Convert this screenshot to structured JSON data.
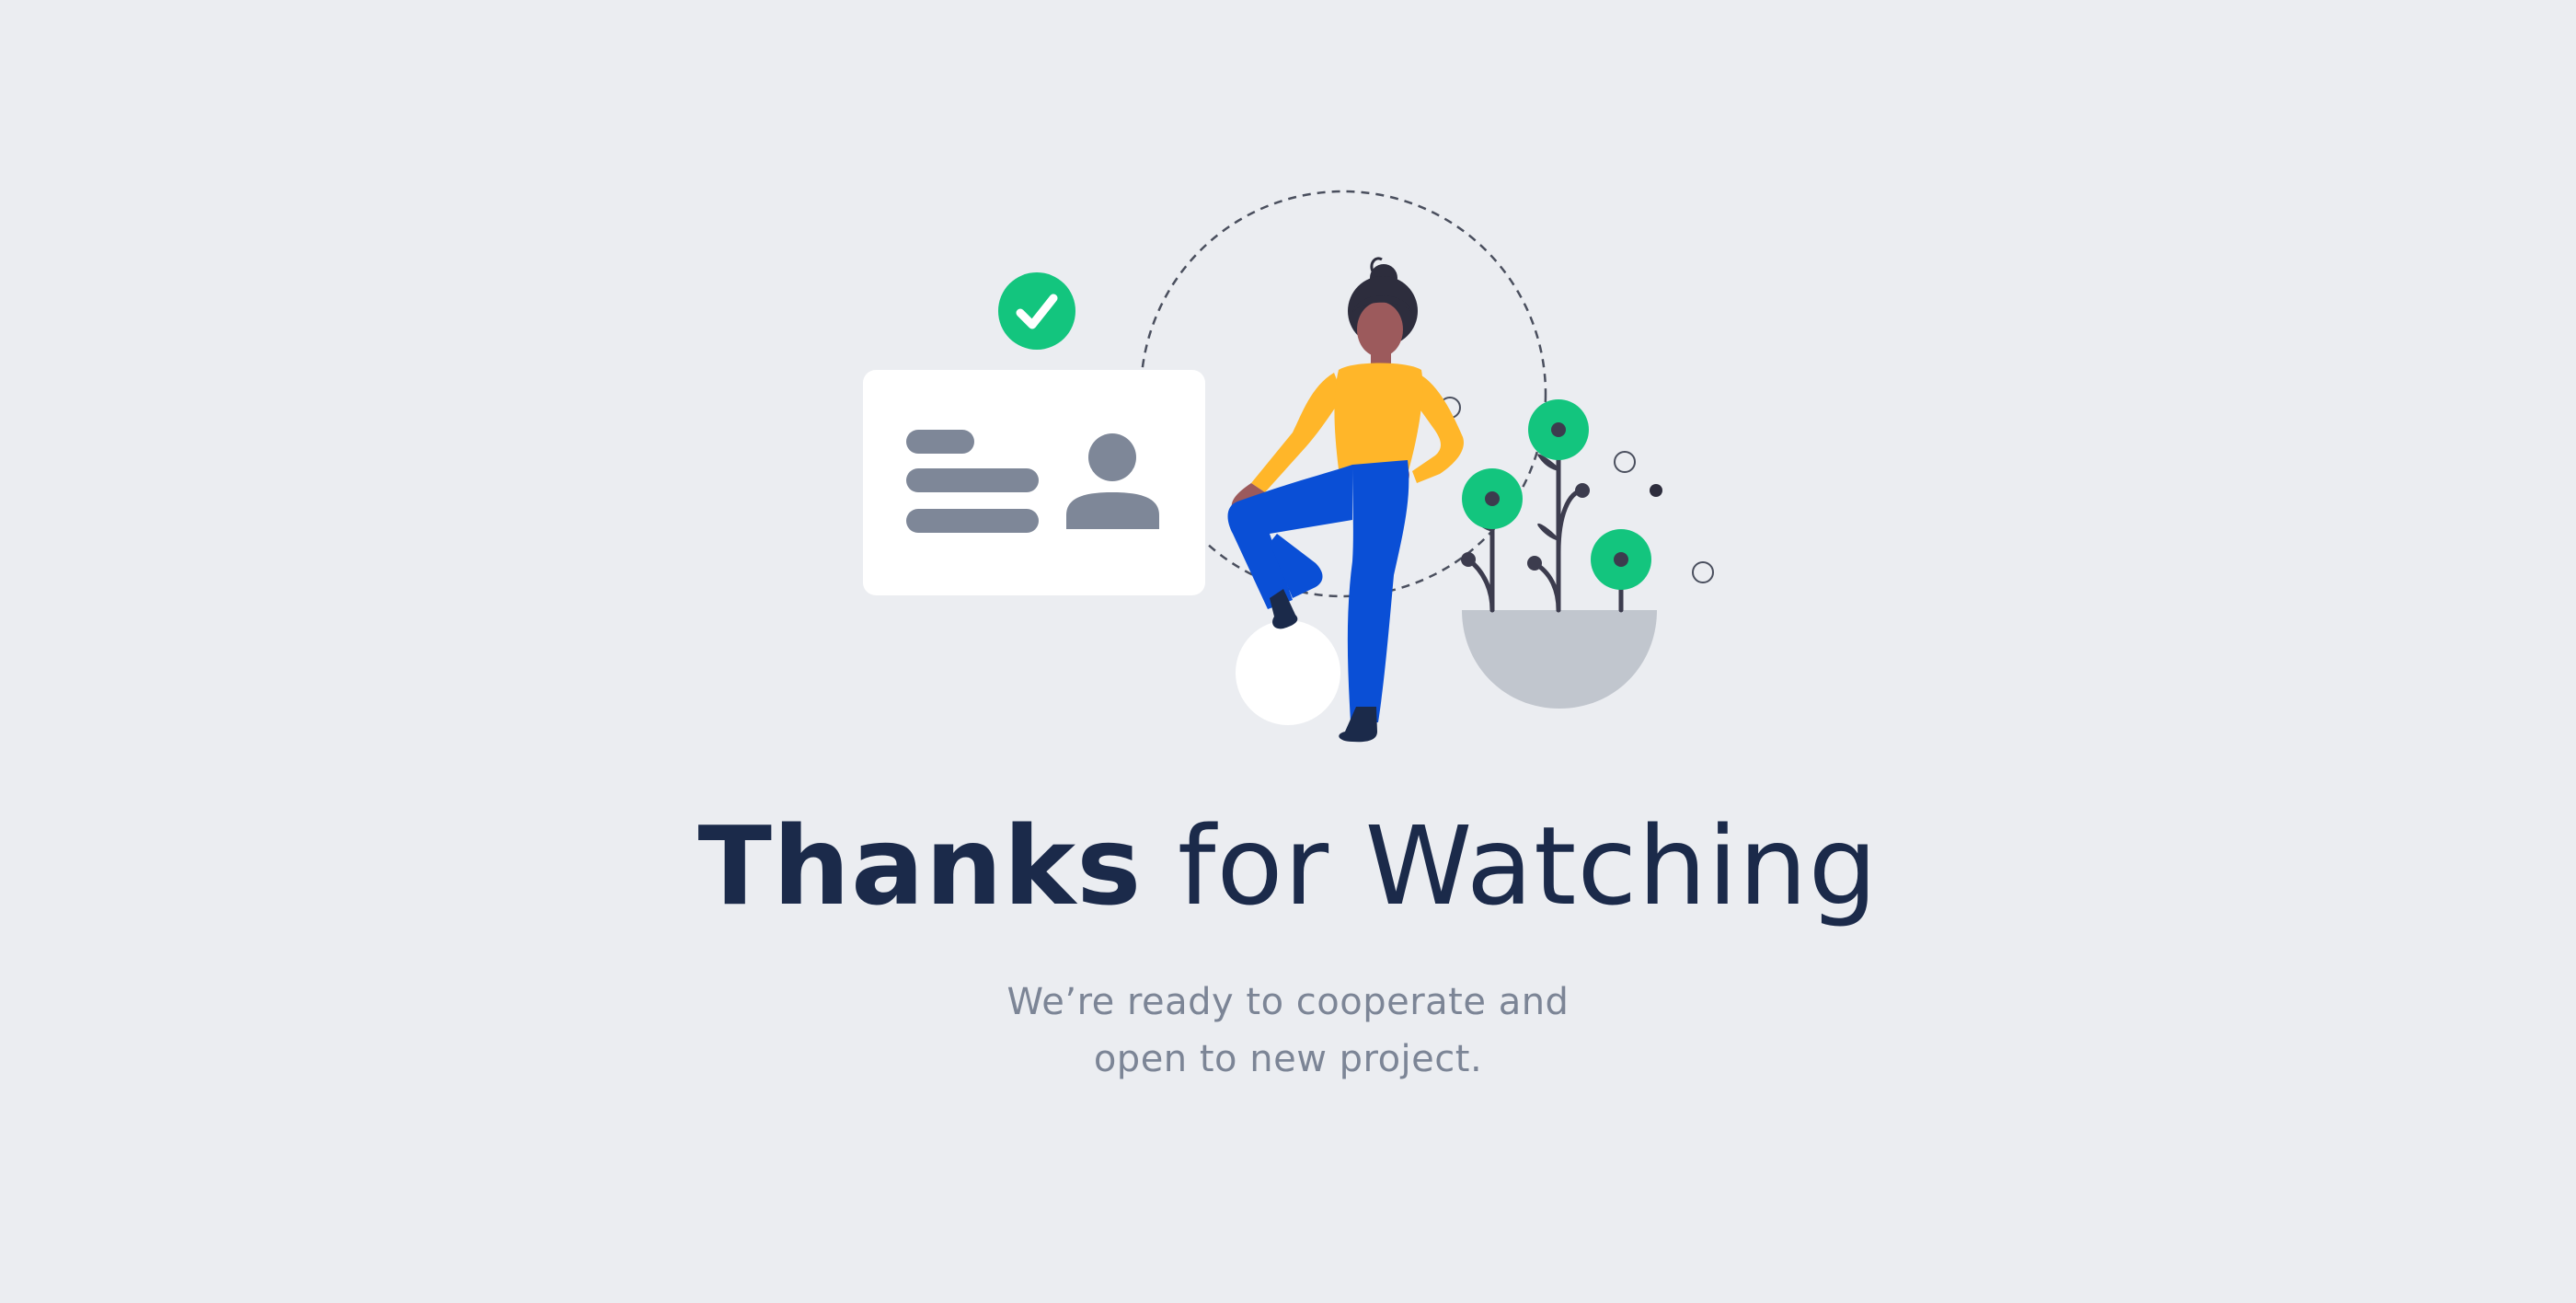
{
  "headline": {
    "bold": "Thanks",
    "rest": "for Watching"
  },
  "subtitle": {
    "line1": "We’re ready to cooperate and",
    "line2": "open to new project."
  },
  "colors": {
    "background": "#ebedf1",
    "headline": "#1b2a4a",
    "subtitle": "#7c8596",
    "green": "#13c57e",
    "yellow": "#ffb629",
    "blue": "#0a4fd6",
    "card": "#ffffff",
    "card_lines": "#7e8798",
    "pot": "#c1c6ce",
    "hair": "#2d2d3d"
  },
  "icons": [
    "check-badge-icon",
    "person-icon",
    "text-lines-icon"
  ]
}
